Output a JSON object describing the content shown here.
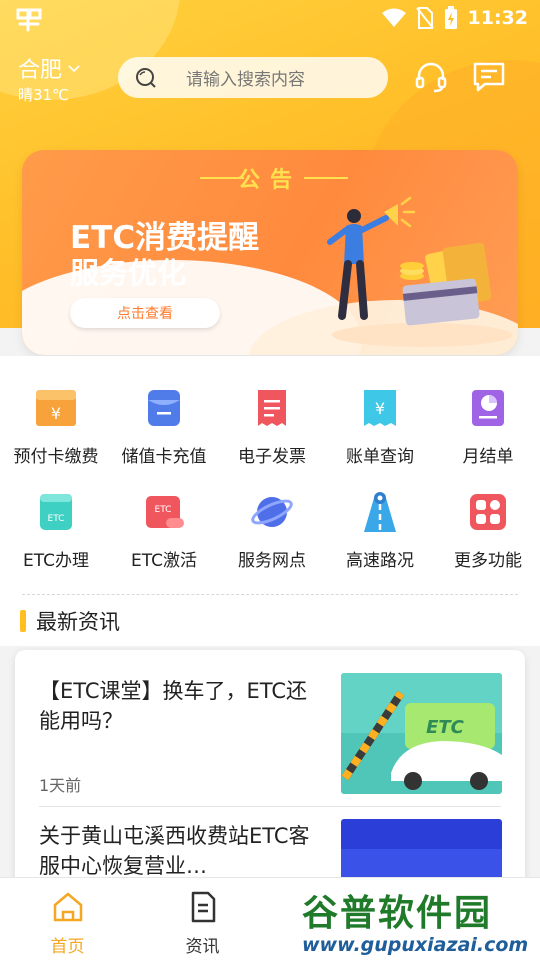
{
  "status": {
    "time": "11:32"
  },
  "header": {
    "city": "合肥",
    "weather": "晴31℃",
    "search_placeholder": "请输入搜索内容"
  },
  "banner": {
    "notice": "公告",
    "line1": "ETC消费提醒",
    "line2": "服务优化",
    "button": "点击查看"
  },
  "services": [
    {
      "label": "预付卡缴费",
      "icon": "prepaid-card-icon"
    },
    {
      "label": "储值卡充值",
      "icon": "stored-value-card-icon"
    },
    {
      "label": "电子发票",
      "icon": "e-invoice-icon"
    },
    {
      "label": "账单查询",
      "icon": "bill-query-icon"
    },
    {
      "label": "月结单",
      "icon": "monthly-statement-icon"
    },
    {
      "label": "ETC办理",
      "icon": "etc-apply-icon"
    },
    {
      "label": "ETC激活",
      "icon": "etc-activate-icon"
    },
    {
      "label": "服务网点",
      "icon": "service-outlet-icon"
    },
    {
      "label": "高速路况",
      "icon": "highway-traffic-icon"
    },
    {
      "label": "更多功能",
      "icon": "more-functions-icon"
    }
  ],
  "news": {
    "title": "最新资讯",
    "items": [
      {
        "title": "【ETC课堂】换车了，ETC还能用吗？",
        "time": "1天前"
      },
      {
        "title": "关于黄山屯溪西收费站ETC客服中心恢复营业…",
        "time": ""
      }
    ]
  },
  "tabs": [
    {
      "label": "首页",
      "icon": "home-icon",
      "active": true
    },
    {
      "label": "资讯",
      "icon": "news-icon",
      "active": false
    }
  ],
  "colors": {
    "accent": "#ffbf20",
    "tab_active": "#f5a623",
    "banner": "#ff8a3d"
  },
  "watermark": {
    "title": "谷普软件园",
    "url": "www.gupuxiazai.com"
  }
}
